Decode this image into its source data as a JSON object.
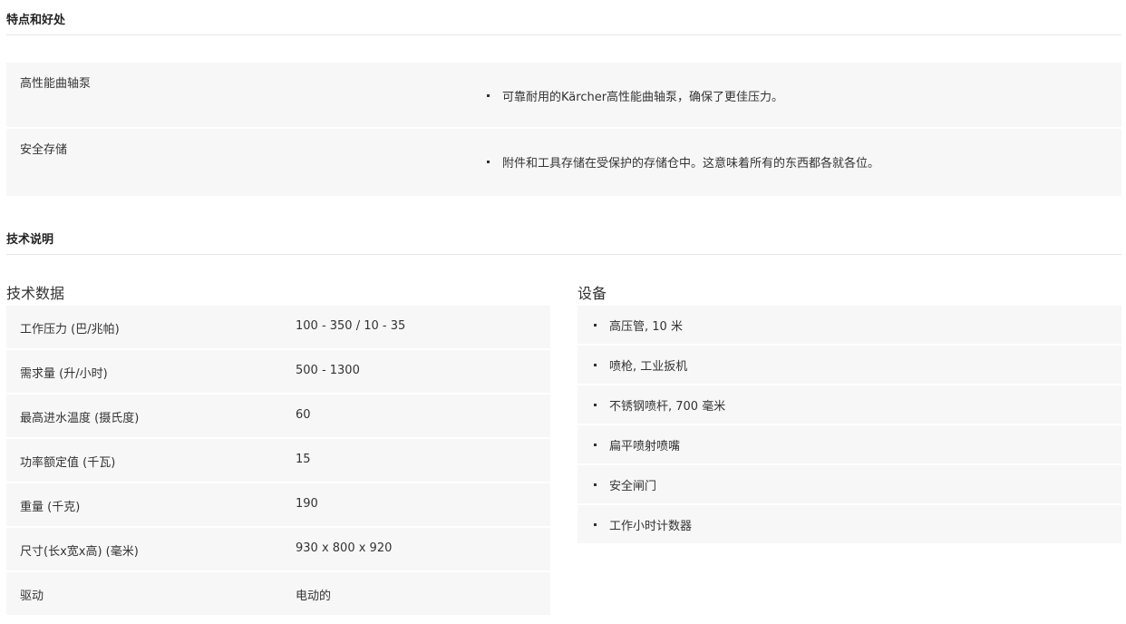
{
  "features_section": {
    "heading": "特点和好处",
    "items": [
      {
        "name": "高性能曲轴泵",
        "description": "可靠耐用的Kärcher高性能曲轴泵，确保了更佳压力。"
      },
      {
        "name": "安全存储",
        "description": "附件和工具存储在受保护的存储仓中。这意味着所有的东西都各就各位。"
      }
    ]
  },
  "tech_section": {
    "heading": "技术说明",
    "data_heading": "技术数据",
    "data_rows": [
      {
        "label": "工作压力 (巴/兆帕)",
        "value": "100 - 350 / 10 - 35"
      },
      {
        "label": "需求量 (升/小时)",
        "value": "500 - 1300"
      },
      {
        "label": "最高进水温度 (摄氏度)",
        "value": "60"
      },
      {
        "label": "功率额定值 (千瓦)",
        "value": "15"
      },
      {
        "label": "重量 (千克)",
        "value": "190"
      },
      {
        "label": "尺寸(长x宽x高) (毫米)",
        "value": "930 x 800 x 920"
      },
      {
        "label": "驱动",
        "value": "电动的"
      }
    ],
    "equipment_heading": "设备",
    "equipment_items": [
      "高压管, 10 米",
      "喷枪, 工业扳机",
      "不锈钢喷杆, 700 毫米",
      "扁平喷射喷嘴",
      "安全闸门",
      "工作小时计数器"
    ]
  }
}
